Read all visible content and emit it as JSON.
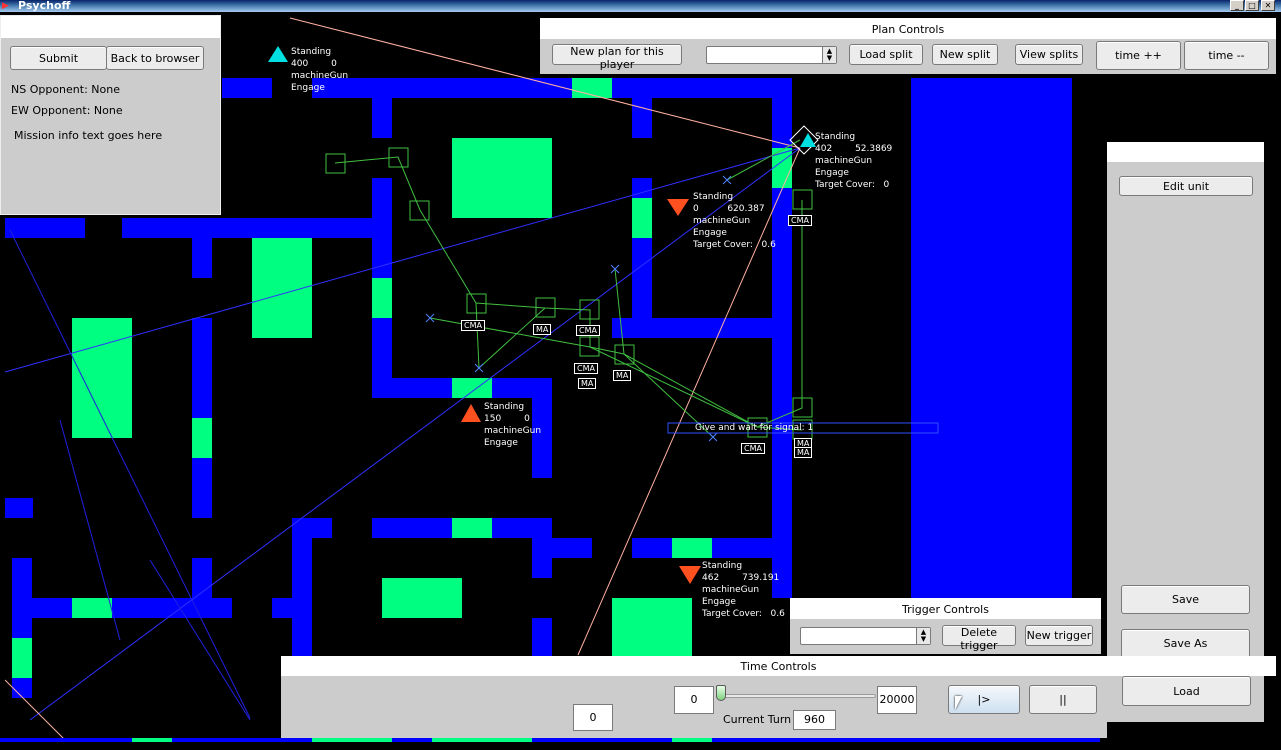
{
  "window": {
    "title": "Psychoff",
    "app_icon": "psychoff-app-icon"
  },
  "mission_panel": {
    "submit_label": "Submit",
    "back_label": "Back to browser",
    "ns_opponent": "NS Opponent: None",
    "ew_opponent": "EW Opponent: None",
    "mission_info": "Mission info text goes here"
  },
  "plan_controls": {
    "title": "Plan Controls",
    "new_plan_label": "New plan for this player",
    "split_select_value": "",
    "load_split_label": "Load split",
    "new_split_label": "New split",
    "view_splits_label": "View splits",
    "time_plus_label": "time ++",
    "time_minus_label": "time --"
  },
  "unit_panel": {
    "edit_unit_label": "Edit unit",
    "save_label": "Save",
    "save_as_label": "Save As",
    "load_label": "Load"
  },
  "trigger_controls": {
    "title": "Trigger Controls",
    "trigger_select_value": "",
    "delete_trigger_label": "Delete trigger",
    "new_trigger_label": "New trigger"
  },
  "time_controls": {
    "title": "Time Controls",
    "slider_min": "0",
    "slider_max": "20000",
    "slider_value": 0,
    "current_turn_label": "Current Turn",
    "current_turn_value": "960",
    "time_field_value": "0",
    "play_label": "|>",
    "pause_label": "||"
  },
  "units": [
    {
      "label": "Standing\n400        0\nmachineGun\nEngage",
      "team": "blue"
    },
    {
      "label": "Standing\n402        52.3869\nmachineGun\nEngage\nTarget Cover:   0",
      "team": "blue"
    },
    {
      "label": "Standing\n0          620.387\nmachineGun\nEngage\nTarget Cover:   0.6",
      "team": "red"
    },
    {
      "label": "Standing\n150        0\nmachineGun\nEngage",
      "team": "red"
    },
    {
      "label": "Standing\n462        739.191\nmachineGun\nEngage\nTarget Cover:   0.6",
      "team": "red"
    }
  ],
  "move_labels": [
    "CMA",
    "MA",
    "CMA",
    "CMA",
    "MA",
    "MA",
    "CMA",
    "CMA",
    "MA",
    "MA"
  ],
  "signal_label": "Give and wait for signal: 1",
  "colors": {
    "wall": "#0000ff",
    "vegetation": "#00ff80",
    "blue_team": "#00e0e0",
    "red_team": "#ff5020",
    "path": "#40c040",
    "panel": "#cccccc"
  }
}
